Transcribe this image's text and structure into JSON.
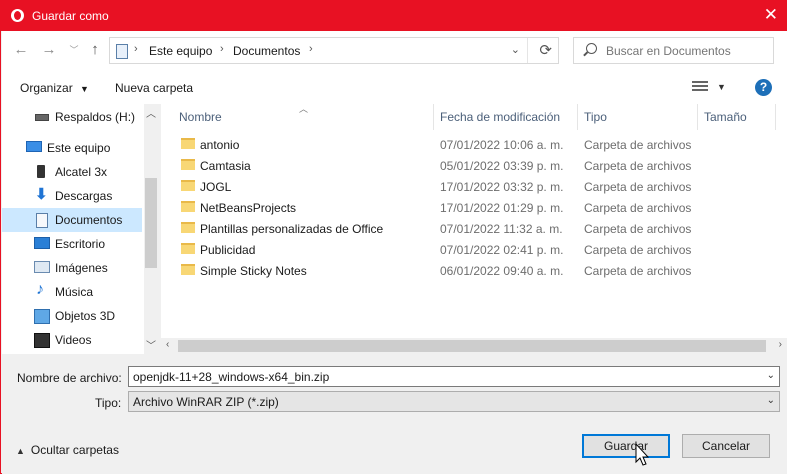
{
  "window": {
    "title": "Guardar como",
    "close_icon": "close-icon"
  },
  "nav": {
    "path": [
      "Este equipo",
      "Documentos"
    ],
    "search_placeholder": "Buscar en Documentos"
  },
  "toolbar": {
    "organize_label": "Organizar",
    "new_folder_label": "Nueva carpeta"
  },
  "sidebar": {
    "items": [
      {
        "label": "Respaldos (H:)",
        "icon": "drive-icon"
      },
      {
        "label": "Este equipo",
        "icon": "computer-icon"
      },
      {
        "label": "Alcatel 3x",
        "icon": "phone-icon"
      },
      {
        "label": "Descargas",
        "icon": "download-icon"
      },
      {
        "label": "Documentos",
        "icon": "document-icon"
      },
      {
        "label": "Escritorio",
        "icon": "desktop-icon"
      },
      {
        "label": "Imágenes",
        "icon": "pictures-icon"
      },
      {
        "label": "Música",
        "icon": "music-icon"
      },
      {
        "label": "Objetos 3D",
        "icon": "cube-icon"
      },
      {
        "label": "Videos",
        "icon": "video-icon"
      }
    ]
  },
  "file_list": {
    "columns": [
      "Nombre",
      "Fecha de modificación",
      "Tipo",
      "Tamaño"
    ],
    "rows": [
      {
        "name": "antonio",
        "date": "07/01/2022 10:06 a. m.",
        "type": "Carpeta de archivos"
      },
      {
        "name": "Camtasia",
        "date": "05/01/2022 03:39 p. m.",
        "type": "Carpeta de archivos"
      },
      {
        "name": "JOGL",
        "date": "17/01/2022 03:32 p. m.",
        "type": "Carpeta de archivos"
      },
      {
        "name": "NetBeansProjects",
        "date": "17/01/2022 01:29 p. m.",
        "type": "Carpeta de archivos"
      },
      {
        "name": "Plantillas personalizadas de Office",
        "date": "07/01/2022 11:32 a. m.",
        "type": "Carpeta de archivos"
      },
      {
        "name": "Publicidad",
        "date": "07/01/2022 02:41 p. m.",
        "type": "Carpeta de archivos"
      },
      {
        "name": "Simple Sticky Notes",
        "date": "06/01/2022 09:40 a. m.",
        "type": "Carpeta de archivos"
      }
    ]
  },
  "form": {
    "filename_label": "Nombre de archivo:",
    "filename_value": "openjdk-11+28_windows-x64_bin.zip",
    "type_label": "Tipo:",
    "type_value": "Archivo WinRAR ZIP (*.zip)"
  },
  "footer": {
    "hide_folders_label": "Ocultar carpetas",
    "save_label": "Guardar",
    "cancel_label": "Cancelar"
  },
  "colors": {
    "accent": "#e81123",
    "selection": "#cce8ff",
    "primary_border": "#0078d7"
  }
}
